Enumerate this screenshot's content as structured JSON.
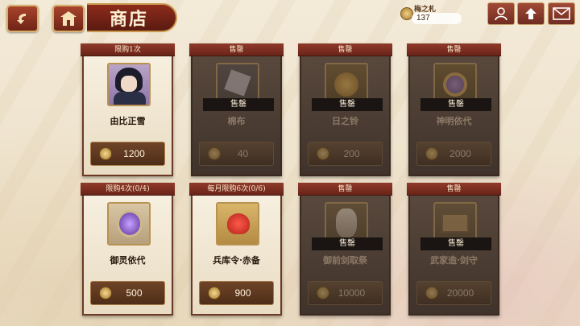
{
  "header": {
    "title": "商店",
    "currency": {
      "name": "梅之札",
      "value": "137"
    }
  },
  "sold_label": "售罄",
  "cards": [
    {
      "ribbon": "限购1次",
      "name": "由比正雪",
      "price": "1200",
      "sold": false,
      "icon": "portrait-art"
    },
    {
      "ribbon": "售罄",
      "name": "棉布",
      "price": "40",
      "sold": true,
      "icon": "cloth-art"
    },
    {
      "ribbon": "售罄",
      "name": "日之铃",
      "price": "200",
      "sold": true,
      "icon": "bell-art"
    },
    {
      "ribbon": "售罄",
      "name": "神明依代",
      "price": "2000",
      "sold": true,
      "icon": "mirror-art"
    },
    {
      "ribbon": "限购4次(0/4)",
      "name": "御灵依代",
      "price": "500",
      "sold": false,
      "icon": "purple-gem-art"
    },
    {
      "ribbon": "每月限购6次(0/6)",
      "name": "兵库令·赤备",
      "price": "900",
      "sold": false,
      "icon": "red-helmet-art"
    },
    {
      "ribbon": "售罄",
      "name": "御前剑取祭",
      "price": "10000",
      "sold": true,
      "icon": "sword-ceremony-art"
    },
    {
      "ribbon": "售罄",
      "name": "武家造·剑守",
      "price": "20000",
      "sold": true,
      "icon": "box-art"
    }
  ]
}
